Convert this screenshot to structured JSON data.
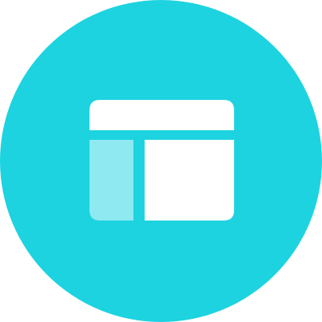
{
  "icon": {
    "name": "layout-icon",
    "background_color": "#1dd3e0",
    "foreground_color": "#ffffff",
    "sidebar_color": "#8eeaf0"
  }
}
